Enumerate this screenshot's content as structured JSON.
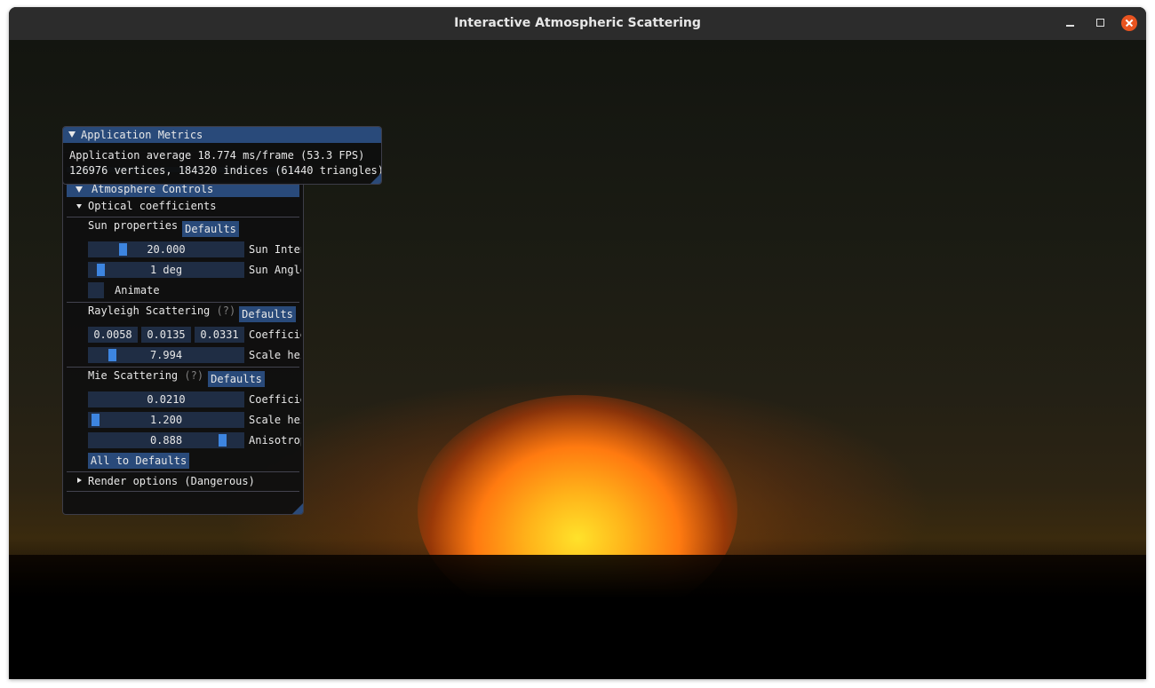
{
  "window": {
    "title": "Interactive Atmospheric Scattering"
  },
  "colors": {
    "imgui_header": "#294a7a",
    "imgui_frame": "#1f2d44",
    "imgui_grab": "#3d85e0",
    "close_button": "#e95420",
    "sun_core": "#ffe22a"
  },
  "metrics": {
    "title": "Application Metrics",
    "line1": "Application average 18.774 ms/frame (53.3 FPS)",
    "line2": "126976 vertices, 184320 indices (61440 triangles)"
  },
  "atmosphere": {
    "header": "Atmosphere Controls",
    "optical": {
      "label": "Optical coefficients"
    },
    "sun": {
      "label": "Sun properties",
      "defaults_label": "Defaults",
      "intensity": {
        "value": "20.000",
        "label": "Sun Intensity",
        "fraction": 0.2
      },
      "angle": {
        "value": "1 deg",
        "label": "Sun Angle",
        "fraction": 0.05
      },
      "animate_label": "Animate"
    },
    "rayleigh": {
      "label": "Rayleigh Scattering",
      "help": "(?)",
      "defaults_label": "Defaults",
      "coeff": [
        "0.0058",
        "0.0135",
        "0.0331"
      ],
      "coeff_label": "Coefficients",
      "scale": {
        "value": "7.994",
        "label": "Scale height",
        "fraction": 0.13
      },
      "scale_label": "Scale height"
    },
    "mie": {
      "label": "Mie Scattering",
      "help": "(?)",
      "defaults_label": "Defaults",
      "coeff": {
        "value": "0.0210",
        "label": "Coefficient"
      },
      "scale": {
        "value": "1.200",
        "label": "Scale height",
        "fraction": 0.01
      },
      "anisotropy": {
        "value": "0.888",
        "label": "Anisotropy",
        "fraction": 0.888
      }
    },
    "all_defaults_label": "All to Defaults",
    "render_options_label": "Render options (Dangerous)"
  }
}
